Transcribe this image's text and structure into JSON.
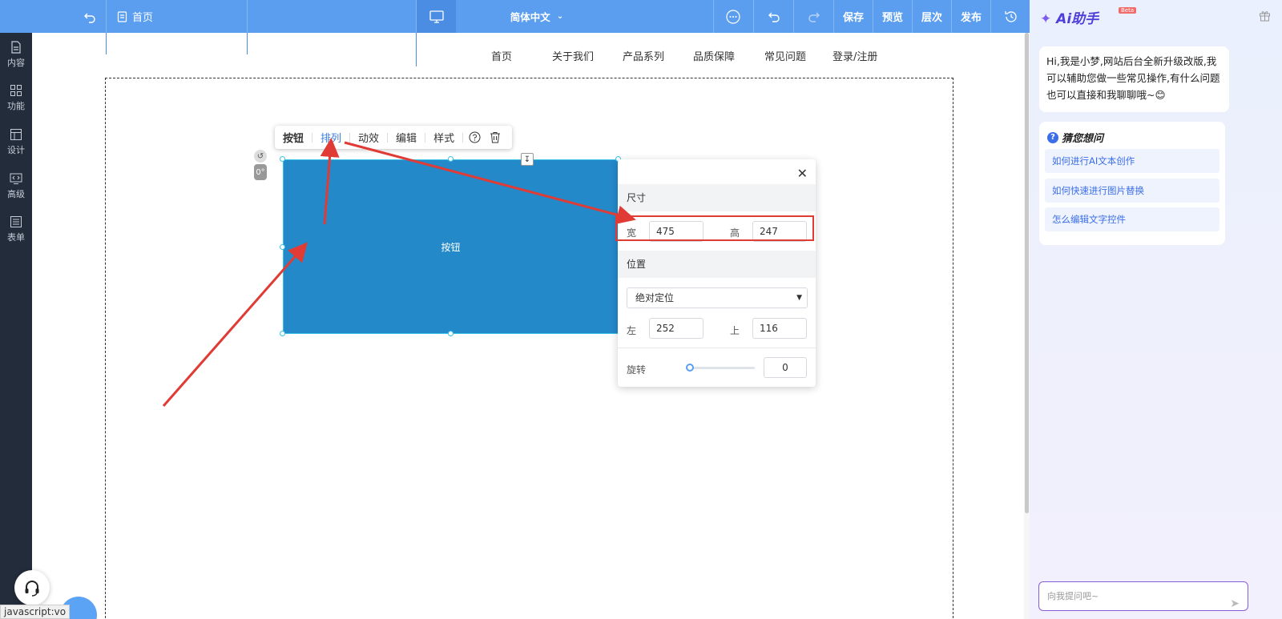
{
  "topbar": {
    "back_icon": "undo-arrow-icon",
    "page_icon": "document-icon",
    "page_label": "首页",
    "language": "简体中文",
    "device_icon": "monitor-icon",
    "more_icon": "more-dots-icon",
    "undo_icon": "undo-icon",
    "redo_icon": "redo-icon",
    "save": "保存",
    "preview": "预览",
    "layers": "层次",
    "publish": "发布",
    "history_icon": "history-icon"
  },
  "leftrail": {
    "items": [
      {
        "label": "内容",
        "icon": "document-icon"
      },
      {
        "label": "功能",
        "icon": "grid-icon"
      },
      {
        "label": "设计",
        "icon": "layout-icon"
      },
      {
        "label": "高级",
        "icon": "code-icon"
      },
      {
        "label": "表单",
        "icon": "form-icon"
      }
    ]
  },
  "site_nav": [
    "首页",
    "关于我们",
    "产品系列",
    "品质保障",
    "常见问题",
    "登录/注册"
  ],
  "float_toolbar": {
    "items": [
      "按钮",
      "排列",
      "动效",
      "编辑",
      "样式"
    ],
    "active": "排列",
    "help_icon": "question-circle-icon",
    "delete_icon": "trash-icon"
  },
  "element": {
    "label": "按钮",
    "rotation_badge": "0°",
    "color": "#2389c9"
  },
  "panel": {
    "size_title": "尺寸",
    "width_label": "宽",
    "width": "475",
    "height_label": "高",
    "height": "247",
    "position_title": "位置",
    "position_mode": "绝对定位",
    "left_label": "左",
    "left": "252",
    "top_label": "上",
    "top": "116",
    "rotate_label": "旋转",
    "rotate": "0",
    "rotate_fraction": 0
  },
  "ai": {
    "title": "Ai助手",
    "badge": "Beta",
    "greeting": "Hi,我是小梦,网站后台全新升级改版,我可以辅助您做一些常见操作,有什么问题也可以直接和我聊聊哦~😊",
    "guess_title": "猜您想问",
    "suggestions": [
      "如何进行AI文本创作",
      "如何快速进行图片替换",
      "怎么编辑文字控件"
    ],
    "input_placeholder": "向我提问吧~"
  },
  "status_url": "javascript:vo",
  "accent": "#5b9ef0",
  "annotation_color": "#e03b35"
}
